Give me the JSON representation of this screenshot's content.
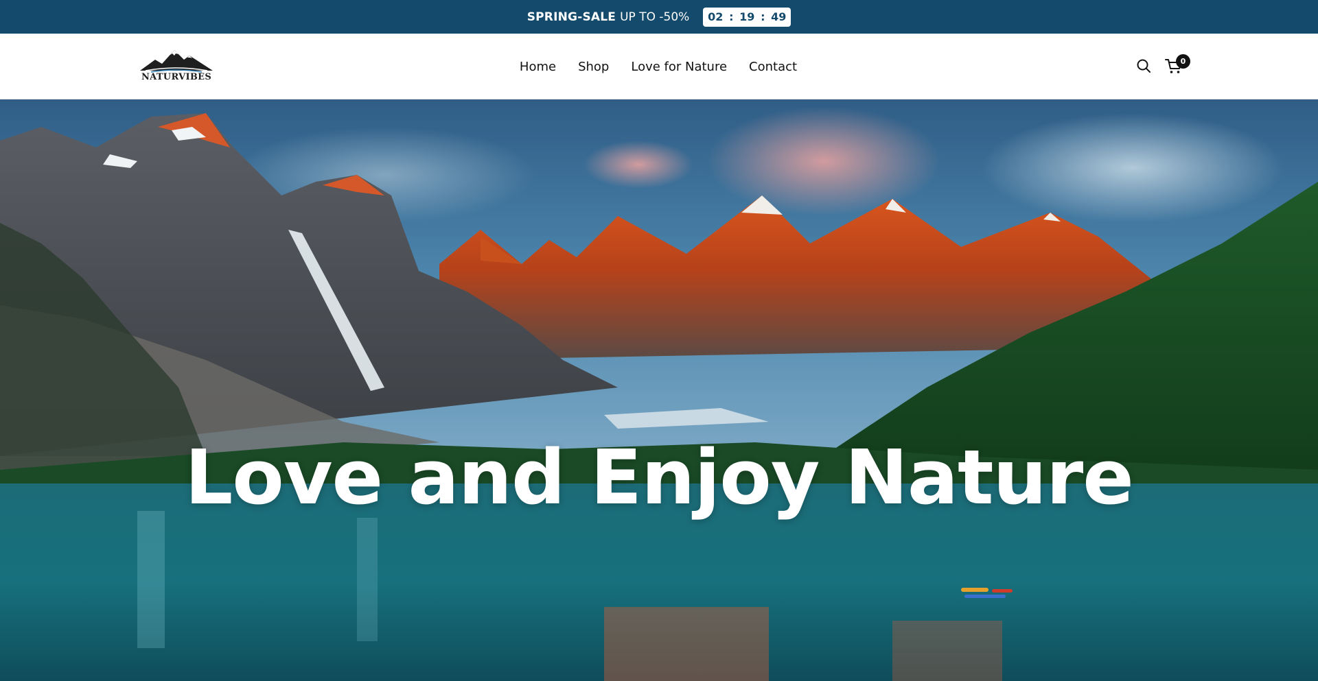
{
  "announcement": {
    "sale_strong": "SPRING-SALE",
    "sale_rest": "UP TO -50%",
    "countdown": {
      "hours": "02",
      "minutes": "19",
      "seconds": "49",
      "separator": ":"
    }
  },
  "header": {
    "logo_text": "NATURVIBES",
    "nav": [
      "Home",
      "Shop",
      "Love for Nature",
      "Contact"
    ],
    "cart_count": "0",
    "icons": {
      "search": "search-icon",
      "cart": "cart-icon"
    }
  },
  "hero": {
    "title": "Love and Enjoy Nature"
  },
  "colors": {
    "announcement_bg": "#144a6b",
    "header_bg": "#ffffff",
    "nav_text": "#111111",
    "hero_title": "#ffffff"
  }
}
